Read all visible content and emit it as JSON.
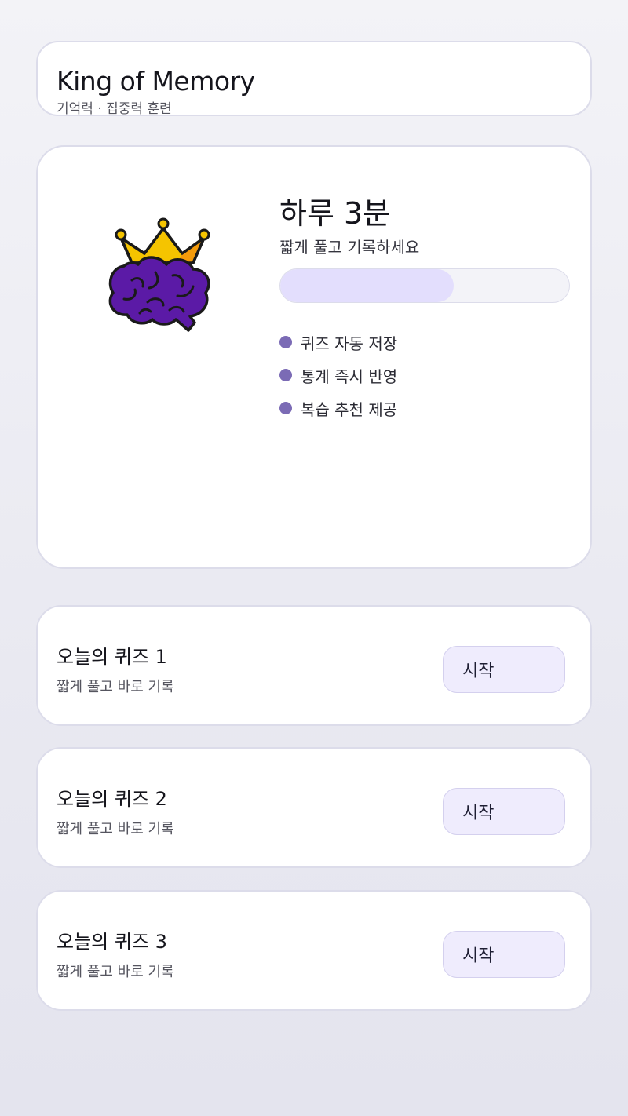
{
  "header": {
    "title": "King of Memory",
    "subtitle": "기억력 · 집중력 훈련"
  },
  "hero": {
    "logo_icon": "crowned-brain-icon",
    "title": "하루 3분",
    "subtitle": "짧게 풀고 기록하세요",
    "progress": 0.6,
    "features": [
      {
        "label": "퀴즈 자동 저장"
      },
      {
        "label": "통계 즉시 반영"
      },
      {
        "label": "복습 추천 제공"
      }
    ]
  },
  "quizzes": [
    {
      "title": "오늘의 퀴즈 1",
      "subtitle": "짧게 풀고 바로 기록",
      "button": "시작"
    },
    {
      "title": "오늘의 퀴즈 2",
      "subtitle": "짧게 풀고 바로 기록",
      "button": "시작"
    },
    {
      "title": "오늘의 퀴즈 3",
      "subtitle": "짧게 풀고 바로 기록",
      "button": "시작"
    }
  ],
  "colors": {
    "accent": "#5b1aa6",
    "crown": "#f5c400",
    "bullet": "#7b6bb5",
    "progress_fill": "#e3defd",
    "button_bg": "#efecfd"
  }
}
